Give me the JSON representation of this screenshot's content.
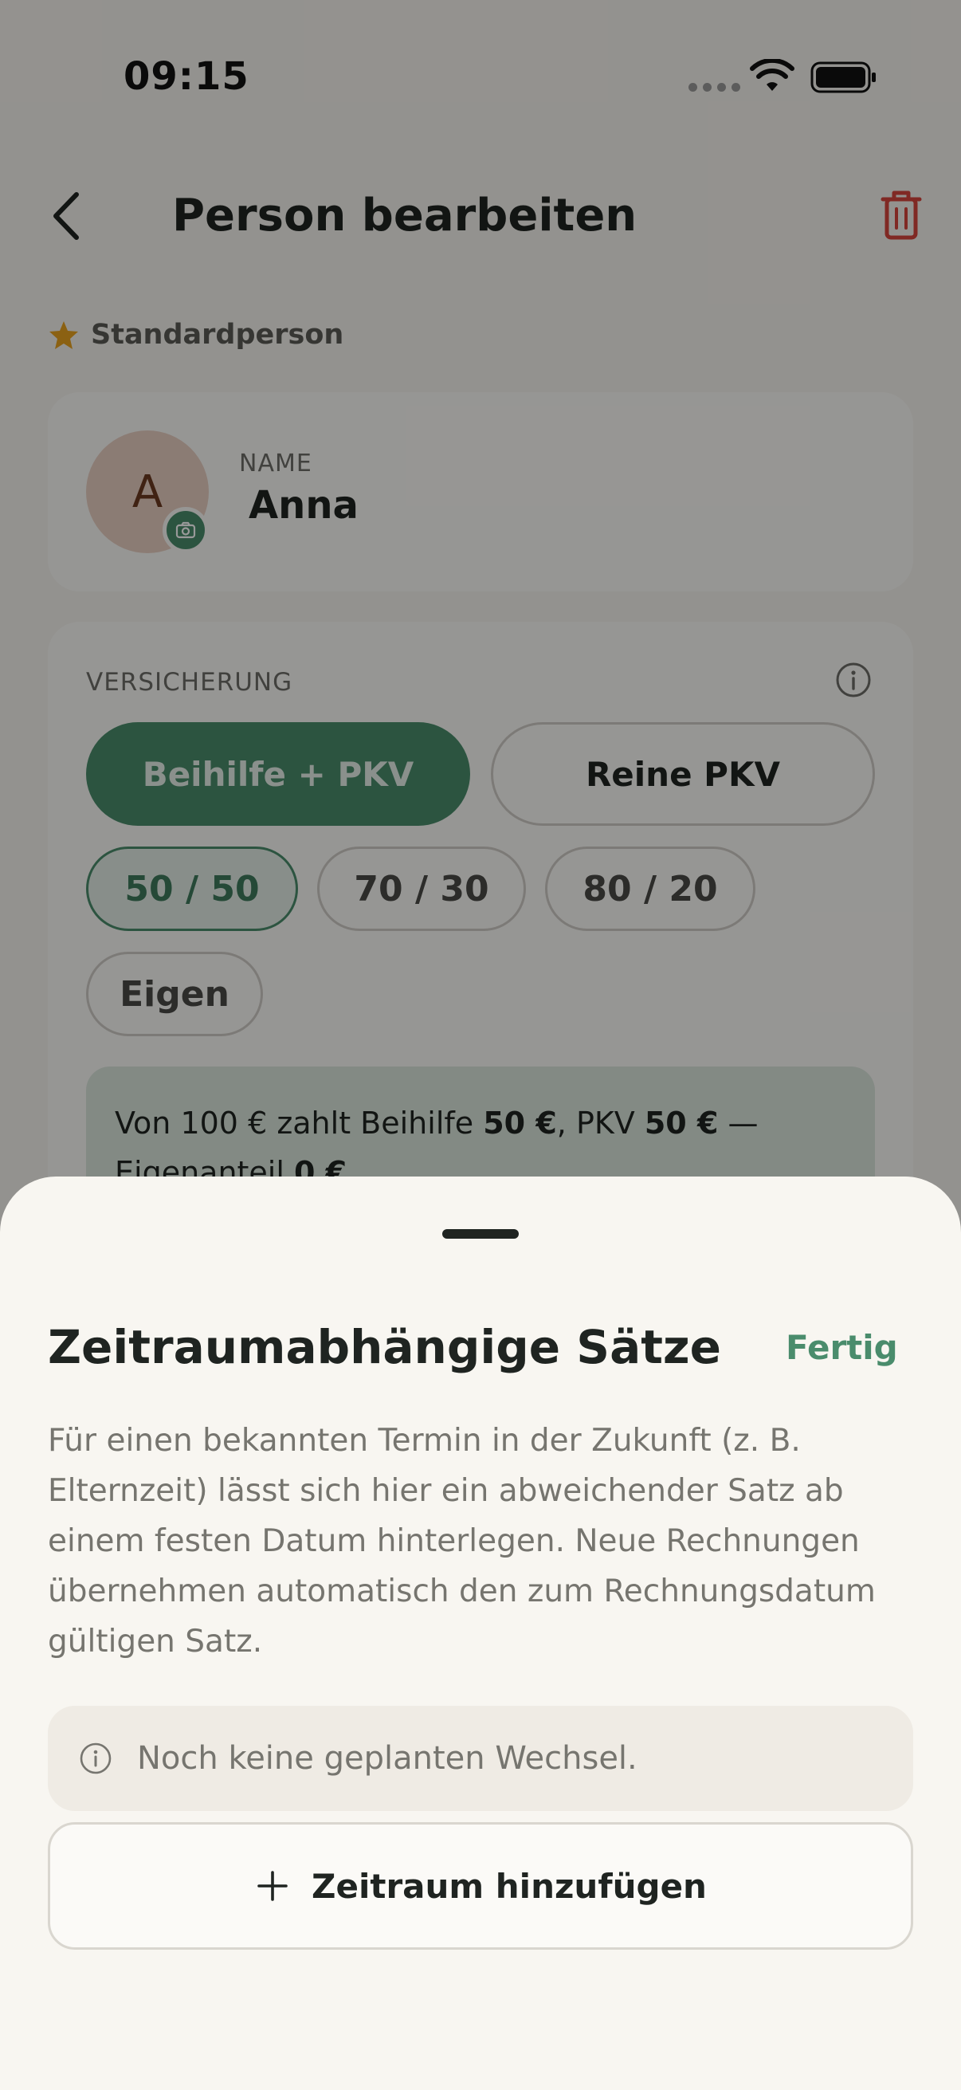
{
  "status_bar": {
    "time": "09:15"
  },
  "header": {
    "title": "Person bearbeiten",
    "back_icon": "chevron-left-icon",
    "delete_icon": "trash-icon"
  },
  "default_person": {
    "label": "Standardperson",
    "icon": "star-icon"
  },
  "person": {
    "avatar_initial": "A",
    "name_label": "NAME",
    "name": "Anna"
  },
  "insurance": {
    "label": "VERSICHERUNG",
    "types": [
      "Beihilfe + PKV",
      "Reine PKV"
    ],
    "selected_type": "Beihilfe + PKV",
    "splits": [
      "50 / 50",
      "70 / 30",
      "80 / 20",
      "Eigen"
    ],
    "selected_split": "50 / 50",
    "note": {
      "prefix": "Von 100 € zahlt Beihilfe ",
      "beihilfe": "50 €",
      "mid": ", PKV ",
      "pkv": "50 €",
      "dash": " —",
      "own_prefix": "Eigenanteil ",
      "own": "0 €"
    }
  },
  "sheet": {
    "title": "Zeitraumabhängige Sätze",
    "done_label": "Fertig",
    "description": "Für einen bekannten Termin in der Zukunft (z. B. Elternzeit) lässt sich hier ein abweichender Satz ab einem festen Datum hinterlegen. Neue Rechnungen übernehmen automatisch den zum Rechnungsdatum gültigen Satz.",
    "empty_text": "Noch keine geplanten Wechsel.",
    "add_label": "Zeitraum hinzufügen"
  },
  "colors": {
    "accent": "#4a8c6c",
    "danger": "#d6453d",
    "star": "#e8a21f",
    "background": "#f6f4ef"
  }
}
